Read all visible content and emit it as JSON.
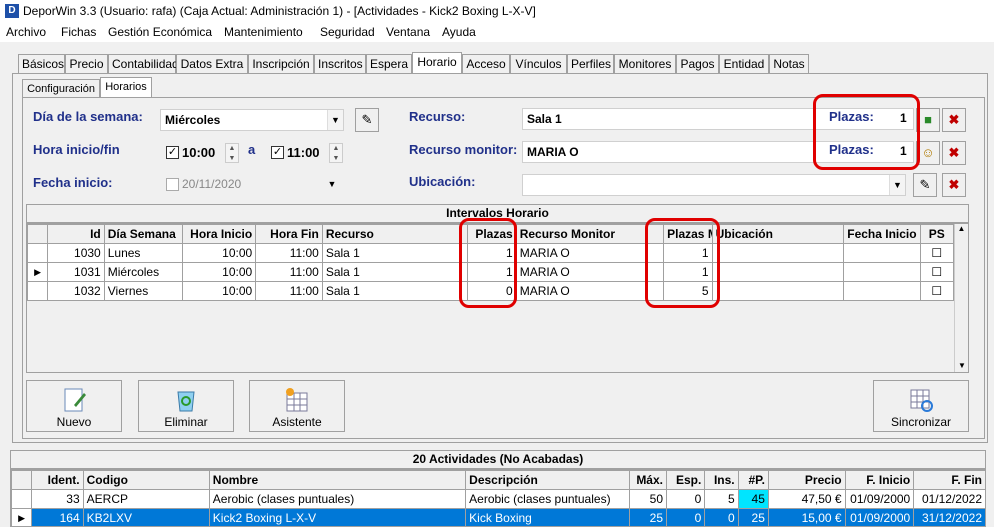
{
  "window": {
    "app_icon": "D",
    "title": "DeporWin 3.3  (Usuario: rafa)  (Caja Actual: Administración 1) - [Actividades - Kick2 Boxing  L-X-V]"
  },
  "menu": [
    "Archivo",
    "Fichas",
    "Gestión Económica",
    "Mantenimiento",
    "Seguridad",
    "Ventana",
    "Ayuda"
  ],
  "tabs": [
    "Básicos",
    "Precio",
    "Contabilidad",
    "Datos Extra",
    "Inscripción",
    "Inscritos",
    "Espera",
    "Horario",
    "Acceso",
    "Vínculos",
    "Perfiles",
    "Monitores",
    "Pagos",
    "Entidad",
    "Notas"
  ],
  "active_tab": "Horario",
  "subtabs": [
    "Configuración",
    "Horarios"
  ],
  "form": {
    "dia_label": "Día de la semana:",
    "dia_value": "Miércoles",
    "hora_label": "Hora inicio/fin",
    "hora_inicio": "10:00",
    "hora_sep": "a",
    "hora_fin": "11:00",
    "fecha_label": "Fecha inicio:",
    "fecha_value": "20/11/2020",
    "recurso_label": "Recurso:",
    "recurso_value": "Sala 1",
    "recurso_monitor_label": "Recurso monitor:",
    "recurso_monitor_value": "MARIA O",
    "ubicacion_label": "Ubicación:",
    "ubicacion_value": "",
    "plazas_label": "Plazas:",
    "plazas_value": "1",
    "plazas2_label": "Plazas:",
    "plazas2_value": "1"
  },
  "intervalos": {
    "title": "Intervalos Horario",
    "columns": [
      "Id",
      "Día Semana",
      "Hora Inicio",
      "Hora Fin",
      "Recurso",
      "Plazas",
      "Recurso Monitor",
      "Plazas M.",
      "Ubicación",
      "Fecha Inicio",
      "PS"
    ],
    "rows": [
      [
        "1030",
        "Lunes",
        "10:00",
        "11:00",
        "Sala 1",
        "1",
        "MARIA O",
        "1",
        "",
        ""
      ],
      [
        "1031",
        "Miércoles",
        "10:00",
        "11:00",
        "Sala 1",
        "1",
        "MARIA O",
        "1",
        "",
        ""
      ],
      [
        "1032",
        "Viernes",
        "10:00",
        "11:00",
        "Sala 1",
        "0",
        "MARIA O",
        "5",
        "",
        ""
      ]
    ]
  },
  "buttons": {
    "nuevo": "Nuevo",
    "eliminar": "Eliminar",
    "asistente": "Asistente",
    "sincronizar": "Sincronizar"
  },
  "actividades": {
    "title": "20 Actividades  (No Acabadas)",
    "columns": [
      "Ident.",
      "Codigo",
      "Nombre",
      "Descripción",
      "Máx.",
      "Esp.",
      "Ins.",
      "#P.",
      "Precio",
      "F. Inicio",
      "F. Fin"
    ],
    "rows": [
      [
        "33",
        "AERCP",
        "Aerobic (clases puntuales)",
        "Aerobic (clases puntuales)",
        "50",
        "0",
        "5",
        "45",
        "47,50 €",
        "01/09/2000",
        "01/12/2022"
      ],
      [
        "164",
        "KB2LXV",
        "Kick2 Boxing  L-X-V",
        "Kick Boxing",
        "25",
        "0",
        "0",
        "25",
        "15,00 €",
        "01/09/2000",
        "31/12/2022"
      ]
    ]
  },
  "colors": {
    "label_blue": "#20308a",
    "highlight_red": "#e00000",
    "selection": "#0078d7",
    "cyan_cell": "#00e5ff"
  }
}
